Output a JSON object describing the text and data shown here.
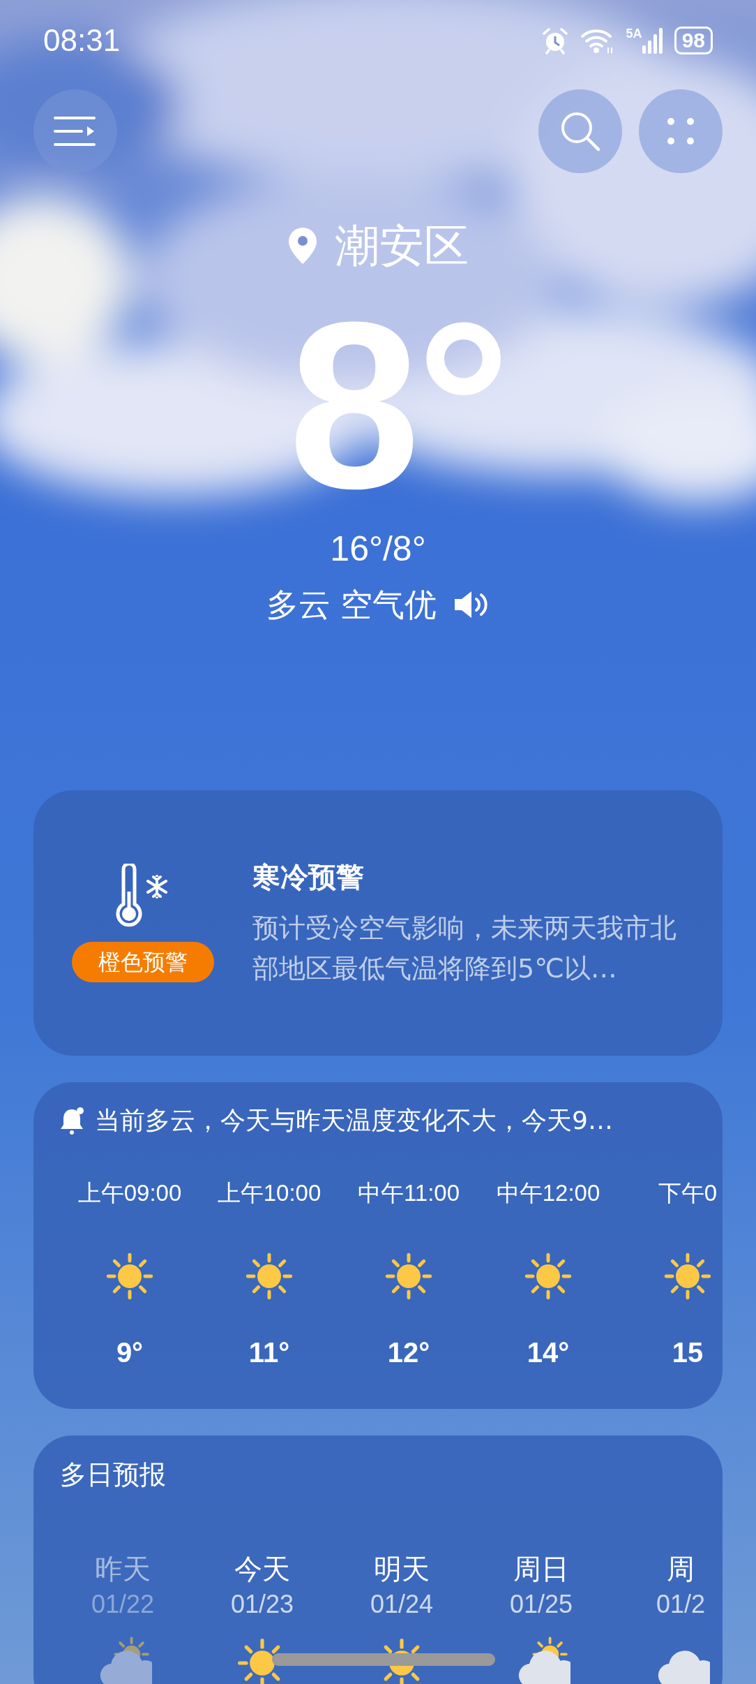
{
  "status_bar": {
    "time": "08:31",
    "network": "5A",
    "battery": "98"
  },
  "location": "潮安区",
  "temperature": "8°",
  "range": "16°/8°",
  "condition": "多云 空气优",
  "alert": {
    "title": "寒冷预警",
    "level_label": "橙色预警",
    "description": "预计受冷空气影响，未来两天我市北部地区最低气温将降到5℃以…"
  },
  "hourly": {
    "summary": "当前多云，今天与昨天温度变化不大，今天9…",
    "items": [
      {
        "time": "上午09:00",
        "kind": "sunny",
        "temp": "9°"
      },
      {
        "time": "上午10:00",
        "kind": "sunny",
        "temp": "11°"
      },
      {
        "time": "中午11:00",
        "kind": "sunny",
        "temp": "12°"
      },
      {
        "time": "中午12:00",
        "kind": "sunny",
        "temp": "14°"
      },
      {
        "time": "下午0",
        "kind": "sunny",
        "temp": "15"
      }
    ]
  },
  "daily": {
    "title": "多日预报",
    "items": [
      {
        "day": "昨天",
        "date": "01/22",
        "kind": "partly-cloudy",
        "past": true
      },
      {
        "day": "今天",
        "date": "01/23",
        "kind": "sunny",
        "past": false
      },
      {
        "day": "明天",
        "date": "01/24",
        "kind": "sunny",
        "past": false
      },
      {
        "day": "周日",
        "date": "01/25",
        "kind": "partly-cloudy",
        "past": false
      },
      {
        "day": "周",
        "date": "01/2",
        "kind": "cloudy",
        "past": false
      }
    ]
  }
}
